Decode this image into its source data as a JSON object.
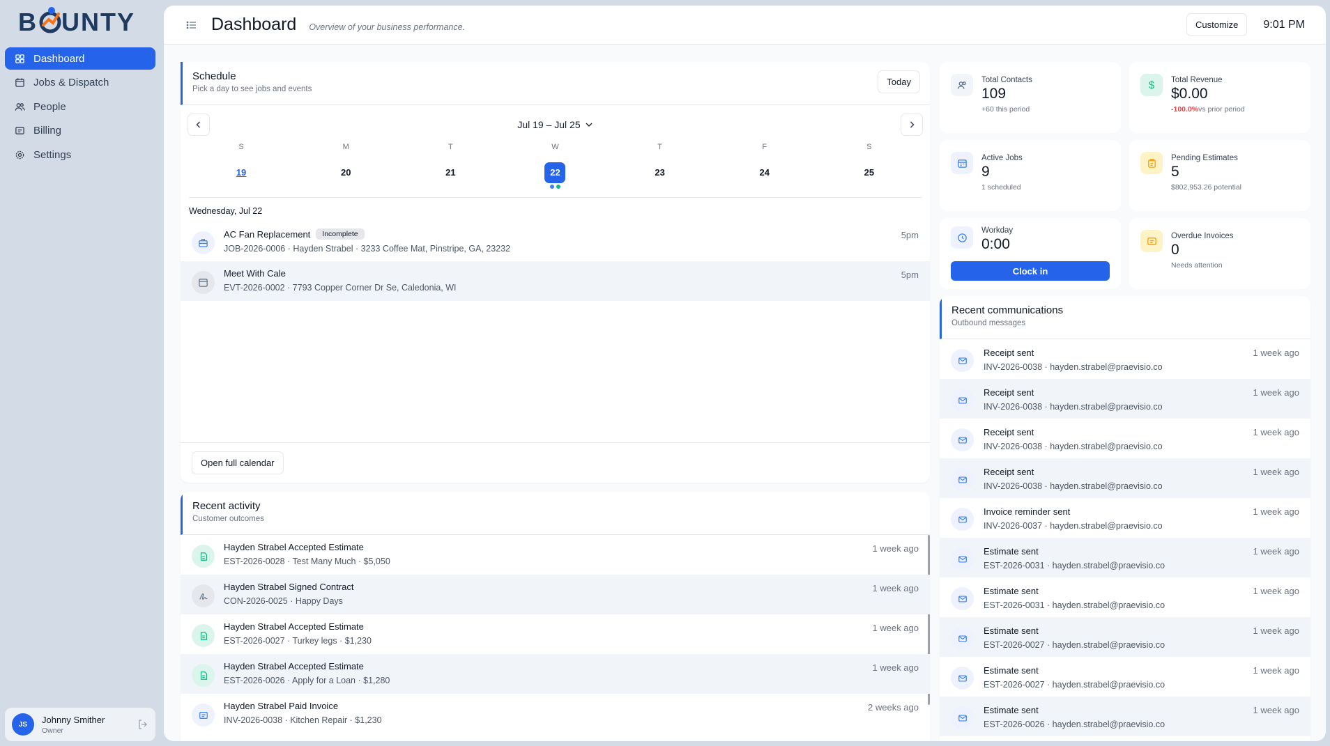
{
  "brand": {
    "name": "BOUNTY",
    "colors": {
      "primary": "#2563eb",
      "accent": "#f97316"
    }
  },
  "sidebar": {
    "items": [
      {
        "label": "Dashboard",
        "icon": "grid-icon",
        "active": true
      },
      {
        "label": "Jobs & Dispatch",
        "icon": "calendar-icon"
      },
      {
        "label": "People",
        "icon": "users-icon"
      },
      {
        "label": "Billing",
        "icon": "billing-icon"
      },
      {
        "label": "Settings",
        "icon": "gear-icon"
      }
    ],
    "user": {
      "initials": "JS",
      "name": "Johnny Smither",
      "role": "Owner"
    }
  },
  "header": {
    "title": "Dashboard",
    "subtitle": "Overview of your business performance.",
    "customize_label": "Customize",
    "time": "9:01 PM"
  },
  "schedule": {
    "title": "Schedule",
    "subtitle": "Pick a day to see jobs and events",
    "today_label": "Today",
    "range": "Jul 19 – Jul 25",
    "days": [
      {
        "letter": "S",
        "num": "19"
      },
      {
        "letter": "M",
        "num": "20"
      },
      {
        "letter": "T",
        "num": "21"
      },
      {
        "letter": "W",
        "num": "22"
      },
      {
        "letter": "T",
        "num": "23"
      },
      {
        "letter": "F",
        "num": "24"
      },
      {
        "letter": "S",
        "num": "25"
      }
    ],
    "selected_date": "Wednesday, Jul 22",
    "events": [
      {
        "title": "AC Fan Replacement",
        "badge": "Incomplete",
        "sub": "JOB-2026-0006 · Hayden Strabel · 3233 Coffee Mat, Pinstripe, GA, 23232",
        "time": "5pm"
      },
      {
        "title": "Meet With Cale",
        "sub": "EVT-2026-0002 · 7793 Copper Corner Dr Se, Caledonia, WI",
        "time": "5pm"
      }
    ],
    "open_calendar_label": "Open full calendar"
  },
  "activity": {
    "title": "Recent activity",
    "subtitle": "Customer outcomes",
    "items": [
      {
        "title": "Hayden Strabel Accepted Estimate",
        "sub": "EST-2026-0028 · Test Many Much · $5,050",
        "time": "1 week ago",
        "icon": "estimate-icon"
      },
      {
        "title": "Hayden Strabel Signed Contract",
        "sub": "CON-2026-0025 · Happy Days",
        "time": "1 week ago",
        "icon": "signature-icon"
      },
      {
        "title": "Hayden Strabel Accepted Estimate",
        "sub": "EST-2026-0027 · Turkey legs · $1,230",
        "time": "1 week ago",
        "icon": "estimate-icon"
      },
      {
        "title": "Hayden Strabel Accepted Estimate",
        "sub": "EST-2026-0026 · Apply for a Loan · $1,280",
        "time": "1 week ago",
        "icon": "estimate-icon"
      },
      {
        "title": "Hayden Strabel Paid Invoice",
        "sub": "INV-2026-0038 · Kitchen Repair · $1,230",
        "time": "2 weeks ago",
        "icon": "invoice-icon"
      }
    ]
  },
  "stats": {
    "contacts": {
      "label": "Total Contacts",
      "value": "109",
      "note": "+60 this period"
    },
    "revenue": {
      "label": "Total Revenue",
      "value": "$0.00",
      "change": "-100.0%",
      "note": "vs prior period"
    },
    "jobs": {
      "label": "Active Jobs",
      "value": "9",
      "note": "1 scheduled"
    },
    "estimates": {
      "label": "Pending Estimates",
      "value": "5",
      "note": "$802,953.26 potential"
    },
    "workday": {
      "label": "Workday",
      "value": "0:00",
      "button": "Clock in"
    },
    "overdue": {
      "label": "Overdue Invoices",
      "value": "0",
      "note": "Needs attention"
    }
  },
  "communications": {
    "title": "Recent communications",
    "subtitle": "Outbound messages",
    "items": [
      {
        "title": "Receipt sent",
        "sub": "INV-2026-0038 · hayden.strabel@praevisio.co",
        "time": "1 week ago"
      },
      {
        "title": "Receipt sent",
        "sub": "INV-2026-0038 · hayden.strabel@praevisio.co",
        "time": "1 week ago"
      },
      {
        "title": "Receipt sent",
        "sub": "INV-2026-0038 · hayden.strabel@praevisio.co",
        "time": "1 week ago"
      },
      {
        "title": "Receipt sent",
        "sub": "INV-2026-0038 · hayden.strabel@praevisio.co",
        "time": "1 week ago"
      },
      {
        "title": "Invoice reminder sent",
        "sub": "INV-2026-0037 · hayden.strabel@praevisio.co",
        "time": "1 week ago"
      },
      {
        "title": "Estimate sent",
        "sub": "EST-2026-0031 · hayden.strabel@praevisio.co",
        "time": "1 week ago"
      },
      {
        "title": "Estimate sent",
        "sub": "EST-2026-0031 · hayden.strabel@praevisio.co",
        "time": "1 week ago"
      },
      {
        "title": "Estimate sent",
        "sub": "EST-2026-0027 · hayden.strabel@praevisio.co",
        "time": "1 week ago"
      },
      {
        "title": "Estimate sent",
        "sub": "EST-2026-0027 · hayden.strabel@praevisio.co",
        "time": "1 week ago"
      },
      {
        "title": "Estimate sent",
        "sub": "EST-2026-0026 · hayden.strabel@praevisio.co",
        "time": "1 week ago"
      }
    ]
  }
}
